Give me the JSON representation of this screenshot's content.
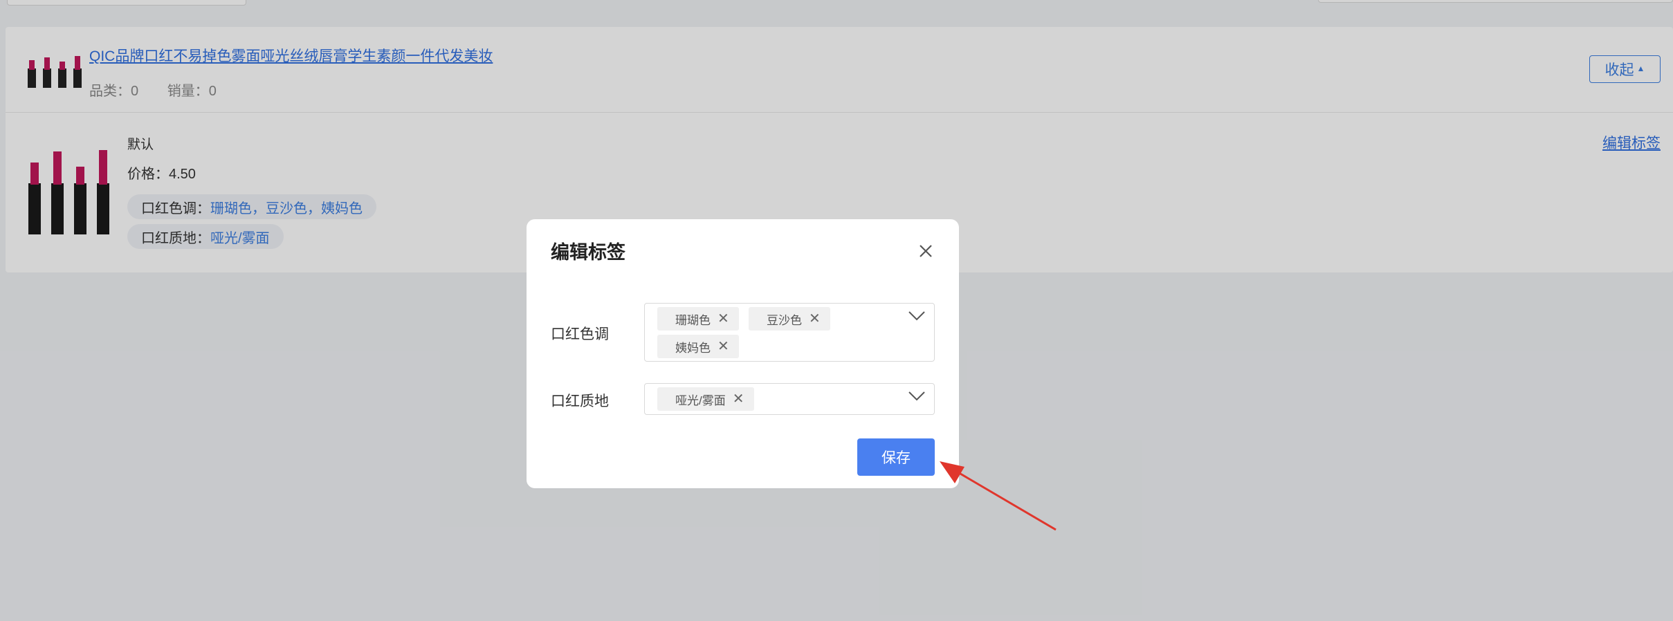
{
  "product": {
    "title": "QIC品牌口红不易掉色雾面哑光丝绒唇膏学生素颜一件代发美妆",
    "category_label": "品类：",
    "category_value": "0",
    "sales_label": "销量：",
    "sales_value": "0",
    "collapse_label": "收起",
    "collapse_caret": "▲"
  },
  "sku": {
    "name": "默认",
    "price": "价格：4.50",
    "edit_link": "编辑标签",
    "tags": [
      {
        "key": "口红色调：",
        "value": "珊瑚色，豆沙色，姨妈色"
      },
      {
        "key": "口红质地：",
        "value": "哑光/雾面"
      }
    ]
  },
  "modal": {
    "title": "编辑标签",
    "fields": [
      {
        "label": "口红色调",
        "chips": [
          "珊瑚色",
          "豆沙色",
          "姨妈色"
        ]
      },
      {
        "label": "口红质地",
        "chips": [
          "哑光/雾面"
        ]
      }
    ],
    "save_label": "保存",
    "chip_remove_glyph": "✕"
  },
  "colors": {
    "accent": "#4a80f0",
    "link": "#2f6fe0",
    "annotation_arrow": "#e0362c",
    "lipstick_body": "#c2185b"
  },
  "icons": [
    "close-icon",
    "chevron-down-icon",
    "caret-up-icon",
    "chip-remove-icon",
    "lipstick-image"
  ]
}
